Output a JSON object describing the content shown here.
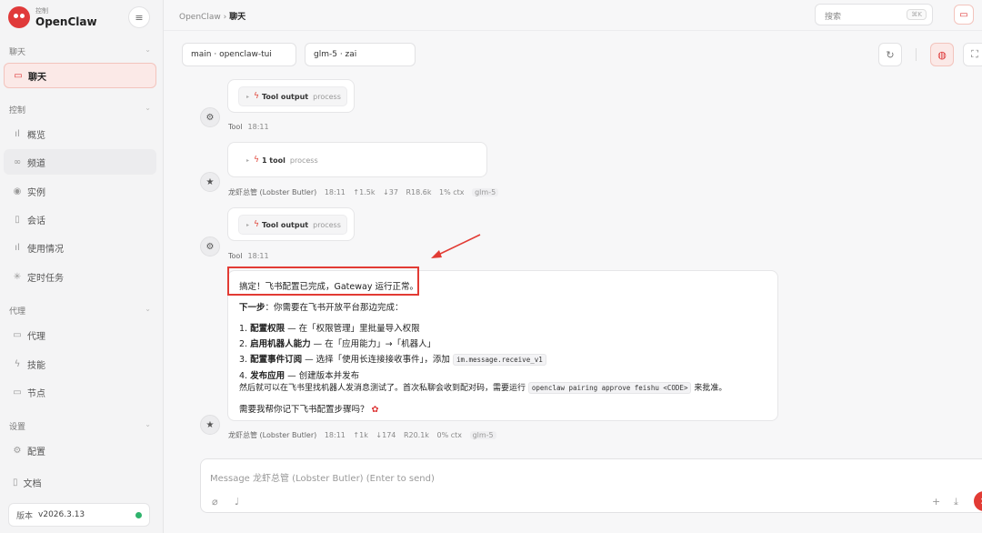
{
  "brand": {
    "sub": "控制",
    "name": "OpenClaw"
  },
  "sidebar": {
    "sections": [
      {
        "label": "聊天"
      },
      {
        "label": "控制"
      },
      {
        "label": "代理"
      },
      {
        "label": "设置"
      }
    ],
    "items": [
      {
        "label": "聊天",
        "icon": "chat-icon"
      },
      {
        "label": "概览",
        "icon": "bar-chart-icon"
      },
      {
        "label": "频道",
        "icon": "link-icon"
      },
      {
        "label": "实例",
        "icon": "broadcast-icon"
      },
      {
        "label": "会话",
        "icon": "document-icon"
      },
      {
        "label": "使用情况",
        "icon": "bar-chart-icon"
      },
      {
        "label": "定时任务",
        "icon": "loader-icon"
      },
      {
        "label": "代理",
        "icon": "folder-icon"
      },
      {
        "label": "技能",
        "icon": "bolt-icon"
      },
      {
        "label": "节点",
        "icon": "monitor-icon"
      },
      {
        "label": "配置",
        "icon": "gear-icon"
      }
    ],
    "docs": "文档",
    "version_label": "版本",
    "version": "v2026.3.13"
  },
  "topbar": {
    "crumb_root": "OpenClaw",
    "crumb_sep": "›",
    "crumb_current": "聊天",
    "search_placeholder": "搜索",
    "search_shortcut": "⌘K"
  },
  "toolbar": {
    "session": "main · openclaw-tui",
    "model": "glm-5 · zai"
  },
  "messages": {
    "tool_output_1": {
      "name": "Tool output",
      "proc": "process"
    },
    "tool_meta_1": {
      "sender": "Tool",
      "time": "18:11"
    },
    "tool_call": {
      "name": "1 tool",
      "proc": "process"
    },
    "assistant_meta_1": {
      "sender": "龙虾总管 (Lobster Butler)",
      "time": "18:11",
      "up": "↑1.5k",
      "down": "↓37",
      "r": "R18.6k",
      "ctx": "1% ctx",
      "model": "glm-5"
    },
    "tool_output_2": {
      "name": "Tool output",
      "proc": "process"
    },
    "tool_meta_2": {
      "sender": "Tool",
      "time": "18:11"
    },
    "reply": {
      "line1": "搞定！飞书配置已完成，Gateway 运行正常。",
      "next_bold": "下一步",
      "next_rest": "：你需要在飞书开放平台那边完成：",
      "steps": [
        {
          "num": "1.",
          "bold": "配置权限",
          "rest": " — 在「权限管理」里批量导入权限"
        },
        {
          "num": "2.",
          "bold": "启用机器人能力",
          "rest": " — 在「应用能力」→「机器人」"
        },
        {
          "num": "3.",
          "bold": "配置事件订阅",
          "rest": " — 选择「使用长连接接收事件」，添加 ",
          "code": "im.message.receive_v1"
        },
        {
          "num": "4.",
          "bold": "发布应用",
          "rest": " — 创建版本并发布"
        }
      ],
      "after_pre": "然后就可以在飞书里找机器人发消息测试了。首次私聊会收到配对码，需要运行 ",
      "after_code": "openclaw pairing approve feishu <CODE>",
      "after_post": " 来批准。",
      "question": "需要我帮你记下飞书配置步骤吗？"
    },
    "assistant_meta_2": {
      "sender": "龙虾总管 (Lobster Butler)",
      "time": "18:11",
      "up": "↑1k",
      "down": "↓174",
      "r": "R20.1k",
      "ctx": "0% ctx",
      "model": "glm-5"
    }
  },
  "composer": {
    "placeholder": "Message 龙虾总管 (Lobster Butler) (Enter to send)"
  },
  "colors": {
    "accent": "#e23b34",
    "active_bg": "#fbe9e7",
    "status_green": "#2fb36c"
  }
}
